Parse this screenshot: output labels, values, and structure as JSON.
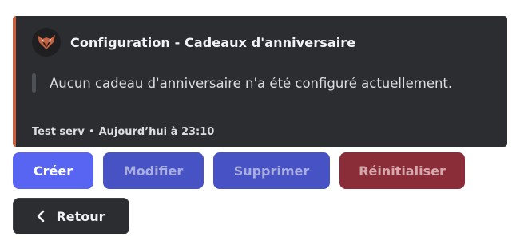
{
  "embed": {
    "accent_color": "#c8613f",
    "author": {
      "icon": "wolf-logo-icon",
      "name": "Configuration - Cadeaux d'anniversaire"
    },
    "description": "Aucun cadeau d'anniversaire n'a été configuré actuellement.",
    "footer": {
      "server": "Test serv",
      "separator": "•",
      "timestamp": "Aujourd’hui à 23:10"
    }
  },
  "buttons": {
    "create": "Créer",
    "edit": "Modifier",
    "delete": "Supprimer",
    "reset": "Réinitialiser",
    "back": "Retour",
    "back_icon": "chevron-left-icon"
  },
  "colors": {
    "primary": "#5865f2",
    "disabled_primary": "#4752c4",
    "danger_disabled": "#8b2d38",
    "secondary": "#2b2d31"
  }
}
